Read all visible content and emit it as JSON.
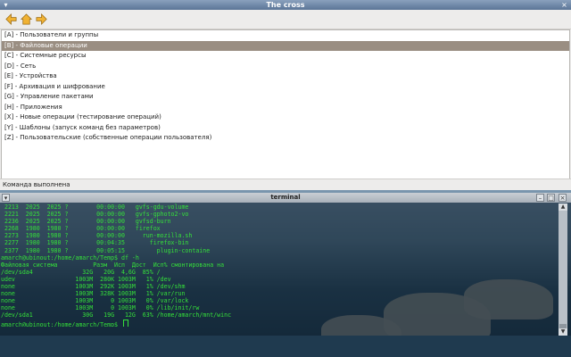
{
  "app": {
    "title": "The cross",
    "toolbar": {
      "icons": [
        "back-arrow-icon",
        "home-icon",
        "forward-arrow-icon"
      ]
    },
    "items": [
      {
        "label": "[A] - Пользователи и группы",
        "selected": false
      },
      {
        "label": "[B] - Файловые операции",
        "selected": true
      },
      {
        "label": "[C] - Системные ресурсы",
        "selected": false
      },
      {
        "label": "[D] - Сеть",
        "selected": false
      },
      {
        "label": "[E] - Устройства",
        "selected": false
      },
      {
        "label": "[F] - Архивация и шифрование",
        "selected": false
      },
      {
        "label": "[G] - Управление пакетами",
        "selected": false
      },
      {
        "label": "[H] - Приложения",
        "selected": false
      },
      {
        "label": "[X] - Новые операции (тестирование операций)",
        "selected": false
      },
      {
        "label": "[Y] - Шаблоны (запуск команд без параметров)",
        "selected": false
      },
      {
        "label": "[Z] - Пользовательские (собственные операции пользователя)",
        "selected": false
      }
    ],
    "status": "Команда выполнена"
  },
  "terminal": {
    "title": "terminal",
    "lines": [
      " 2213  2025  2025 ?        00:00:00   gvfs-gdu-volume",
      " 2221  2025  2025 ?        00:00:00   gvfs-gphoto2-vo",
      " 2236  2025  2025 ?        00:00:00   gvfsd-burn",
      " 2268  1980  1980 ?        00:00:00   firefox",
      " 2273  1980  1980 ?        00:00:00     run-mozilla.sh",
      " 2277  1980  1980 ?        00:04:35       firefox-bin",
      " 2377  1980  1980 ?        00:05:15         plugin-containe",
      "amarch@ubinout:/home/amarch/Temp$ df -h",
      "Файловая система          Разм  Исп  Дост  Исп% смонтирована на",
      "/dev/sda4              32G   20G  4,6G  85% /",
      "udev                 1003M  280K 1003M   1% /dev",
      "none                 1003M  292K 1003M   1% /dev/shm",
      "none                 1003M  328K 1003M   1% /var/run",
      "none                 1003M     0 1003M   0% /var/lock",
      "none                 1003M     0 1003M   0% /lib/init/rw",
      "/dev/sda1              30G   19G   12G  63% /home/amarch/mnt/winc",
      "amarch@ubinout:/home/amarch/Temp$ "
    ]
  },
  "colors": {
    "terminal_text": "#35e03a",
    "selected_row": "#9a8e82",
    "titlebar": "#5b7597"
  }
}
